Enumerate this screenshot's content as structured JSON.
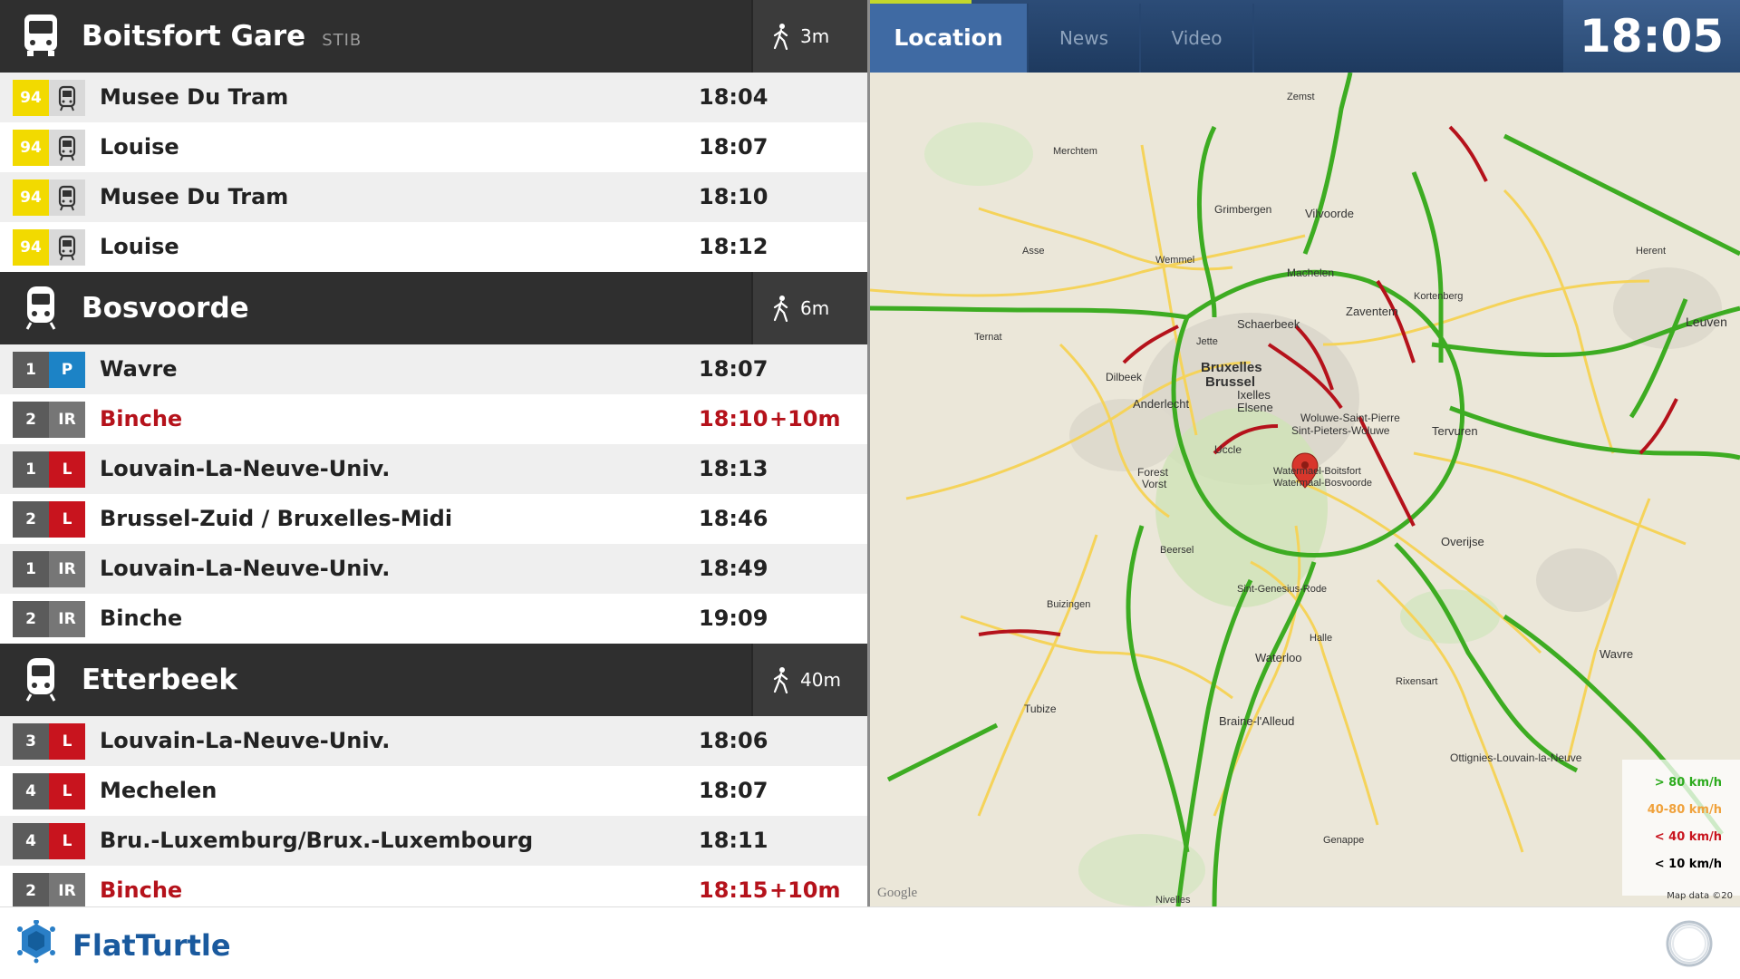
{
  "stations": [
    {
      "name": "Boitsfort Gare",
      "operator": "STIB",
      "walk_time": "3m",
      "icon": "bus-icon",
      "departures": [
        {
          "line": "94",
          "mode": "tram-icon",
          "destination": "Musee Du Tram",
          "time": "18:04",
          "delay": ""
        },
        {
          "line": "94",
          "mode": "tram-icon",
          "destination": "Louise",
          "time": "18:07",
          "delay": ""
        },
        {
          "line": "94",
          "mode": "tram-icon",
          "destination": "Musee Du Tram",
          "time": "18:10",
          "delay": ""
        },
        {
          "line": "94",
          "mode": "tram-icon",
          "destination": "Louise",
          "time": "18:12",
          "delay": ""
        }
      ]
    },
    {
      "name": "Bosvoorde",
      "operator": "",
      "walk_time": "6m",
      "icon": "train-icon",
      "departures": [
        {
          "line": "1",
          "type": "P",
          "destination": "Wavre",
          "time": "18:07",
          "delay": ""
        },
        {
          "line": "2",
          "type": "IR",
          "destination": "Binche",
          "time": "18:10",
          "delay": "+10m"
        },
        {
          "line": "1",
          "type": "L",
          "destination": "Louvain-La-Neuve-Univ.",
          "time": "18:13",
          "delay": ""
        },
        {
          "line": "2",
          "type": "L",
          "destination": "Brussel-Zuid / Bruxelles-Midi",
          "time": "18:46",
          "delay": ""
        },
        {
          "line": "1",
          "type": "IR",
          "destination": "Louvain-La-Neuve-Univ.",
          "time": "18:49",
          "delay": ""
        },
        {
          "line": "2",
          "type": "IR",
          "destination": "Binche",
          "time": "19:09",
          "delay": ""
        }
      ]
    },
    {
      "name": "Etterbeek",
      "operator": "",
      "walk_time": "40m",
      "icon": "train-icon",
      "departures": [
        {
          "line": "3",
          "type": "L",
          "destination": "Louvain-La-Neuve-Univ.",
          "time": "18:06",
          "delay": ""
        },
        {
          "line": "4",
          "type": "L",
          "destination": "Mechelen",
          "time": "18:07",
          "delay": ""
        },
        {
          "line": "4",
          "type": "L",
          "destination": "Bru.-Luxemburg/Brux.-Luxembourg",
          "time": "18:11",
          "delay": ""
        },
        {
          "line": "2",
          "type": "IR",
          "destination": "Binche",
          "time": "18:15",
          "delay": "+10m"
        }
      ]
    }
  ],
  "tabs": [
    {
      "label": "Location",
      "active": true
    },
    {
      "label": "News",
      "active": false
    },
    {
      "label": "Video",
      "active": false
    }
  ],
  "clock": "18:05",
  "map": {
    "labels": [
      "Bruxelles",
      "Brussel",
      "Schaerbeek",
      "Ixelles",
      "Elsene",
      "Anderlecht",
      "Watermael-Boitsfort",
      "Watermaal-Bosvoorde",
      "Vilvoorde",
      "Zaventem",
      "Leuven",
      "Wavre",
      "Waterloo",
      "Braine-l'Alleud",
      "Overijse",
      "Tervuren",
      "Halle",
      "Ottignies-Louvain-la-Neuve",
      "Grimbergen",
      "Machelen",
      "Kortenberg",
      "Forest",
      "Vorst",
      "Uccle",
      "Dilbeek",
      "Woluwe-Saint-Pierre",
      "Sint-Pieters-Woluwe",
      "Sint-Genesius-Rode",
      "Beersel",
      "Tubize",
      "Genappe",
      "Rixensart",
      "Nivelles",
      "Herent",
      "Jette",
      "Zemst",
      "Buizingen",
      "Ternat",
      "Asse",
      "Wemmel",
      "Merchtem"
    ],
    "legend": [
      {
        "label": "> 80 km/h",
        "color": "#2dab1e"
      },
      {
        "label": "40-80 km/h",
        "color": "#f0a23c"
      },
      {
        "label": "< 40 km/h",
        "color": "#c8141e"
      },
      {
        "label": "< 10 km/h",
        "color": "#000000"
      }
    ],
    "credit": "Map data ©20",
    "provider": "Google"
  },
  "footer": {
    "brand": "FlatTurtle"
  },
  "colors": {
    "header_bg": "#2f2f2f",
    "line_94": "#f2da00",
    "type_P": "#1c83c6",
    "type_L": "#c8141e",
    "type_IR": "#767676",
    "delay": "#b5121b",
    "topbar": "#2c4c77",
    "active_tab": "#3f6aa3",
    "brand": "#1a5a9e"
  }
}
